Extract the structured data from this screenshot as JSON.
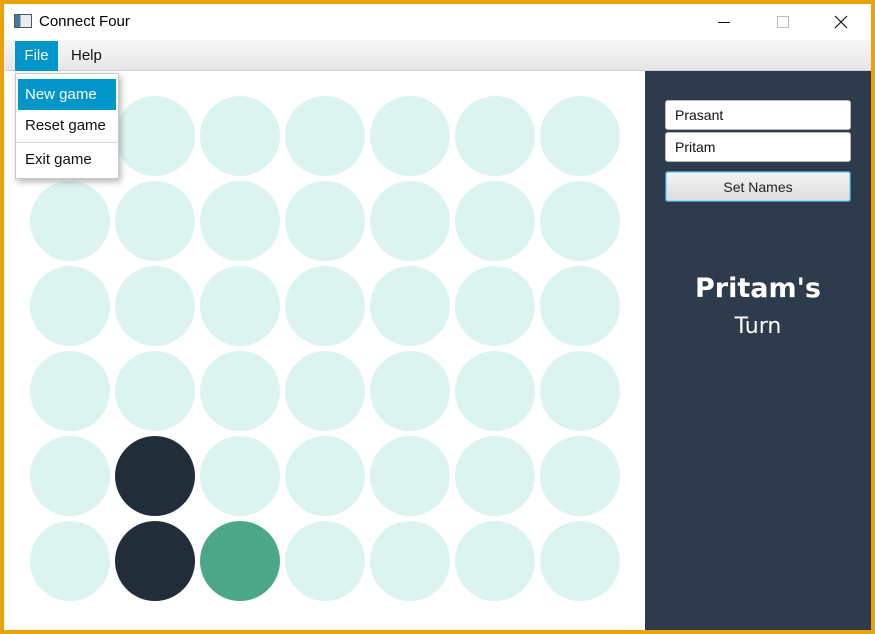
{
  "window": {
    "title": "Connect Four"
  },
  "menu": {
    "file": "File",
    "help": "Help"
  },
  "file_menu": {
    "new_game": "New game",
    "reset_game": "Reset game",
    "exit_game": "Exit game"
  },
  "players": {
    "player1": "Prasant",
    "player2": "Pritam"
  },
  "set_names_button": "Set Names",
  "status": {
    "current_player": "Pritam's",
    "turn_label": "Turn"
  },
  "board": {
    "rows": 6,
    "columns": 7,
    "colors": {
      "empty": "#dbf4ef",
      "player1": "#222d3a",
      "player2": "#4aa888"
    },
    "cells": [
      [
        "empty",
        "empty",
        "empty",
        "empty",
        "empty",
        "empty",
        "empty"
      ],
      [
        "empty",
        "empty",
        "empty",
        "empty",
        "empty",
        "empty",
        "empty"
      ],
      [
        "empty",
        "empty",
        "empty",
        "empty",
        "empty",
        "empty",
        "empty"
      ],
      [
        "empty",
        "empty",
        "empty",
        "empty",
        "empty",
        "empty",
        "empty"
      ],
      [
        "empty",
        "player1",
        "empty",
        "empty",
        "empty",
        "empty",
        "empty"
      ],
      [
        "empty",
        "player1",
        "player2",
        "empty",
        "empty",
        "empty",
        "empty"
      ]
    ]
  }
}
